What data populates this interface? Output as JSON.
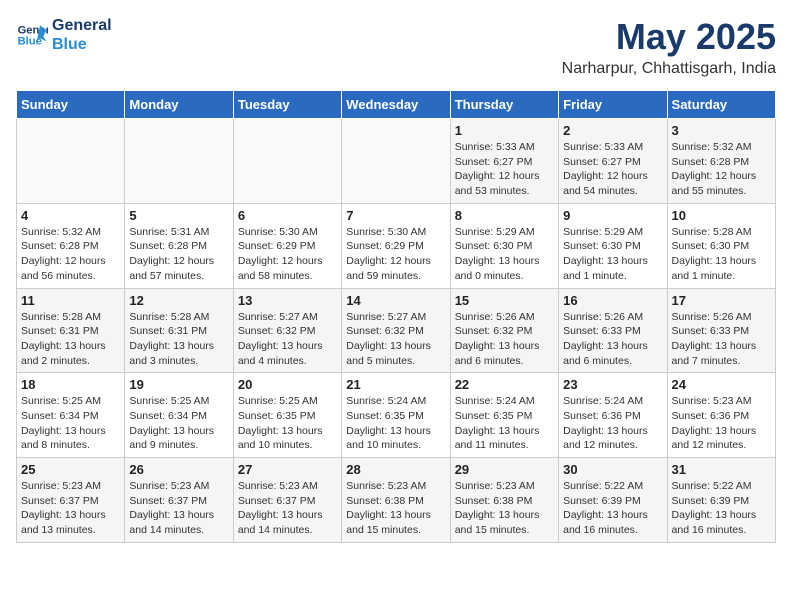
{
  "logo": {
    "line1": "General",
    "line2": "Blue"
  },
  "title": "May 2025",
  "subtitle": "Narharpur, Chhattisgarh, India",
  "days_of_week": [
    "Sunday",
    "Monday",
    "Tuesday",
    "Wednesday",
    "Thursday",
    "Friday",
    "Saturday"
  ],
  "weeks": [
    [
      {
        "day": "",
        "info": ""
      },
      {
        "day": "",
        "info": ""
      },
      {
        "day": "",
        "info": ""
      },
      {
        "day": "",
        "info": ""
      },
      {
        "day": "1",
        "info": "Sunrise: 5:33 AM\nSunset: 6:27 PM\nDaylight: 12 hours\nand 53 minutes."
      },
      {
        "day": "2",
        "info": "Sunrise: 5:33 AM\nSunset: 6:27 PM\nDaylight: 12 hours\nand 54 minutes."
      },
      {
        "day": "3",
        "info": "Sunrise: 5:32 AM\nSunset: 6:28 PM\nDaylight: 12 hours\nand 55 minutes."
      }
    ],
    [
      {
        "day": "4",
        "info": "Sunrise: 5:32 AM\nSunset: 6:28 PM\nDaylight: 12 hours\nand 56 minutes."
      },
      {
        "day": "5",
        "info": "Sunrise: 5:31 AM\nSunset: 6:28 PM\nDaylight: 12 hours\nand 57 minutes."
      },
      {
        "day": "6",
        "info": "Sunrise: 5:30 AM\nSunset: 6:29 PM\nDaylight: 12 hours\nand 58 minutes."
      },
      {
        "day": "7",
        "info": "Sunrise: 5:30 AM\nSunset: 6:29 PM\nDaylight: 12 hours\nand 59 minutes."
      },
      {
        "day": "8",
        "info": "Sunrise: 5:29 AM\nSunset: 6:30 PM\nDaylight: 13 hours\nand 0 minutes."
      },
      {
        "day": "9",
        "info": "Sunrise: 5:29 AM\nSunset: 6:30 PM\nDaylight: 13 hours\nand 1 minute."
      },
      {
        "day": "10",
        "info": "Sunrise: 5:28 AM\nSunset: 6:30 PM\nDaylight: 13 hours\nand 1 minute."
      }
    ],
    [
      {
        "day": "11",
        "info": "Sunrise: 5:28 AM\nSunset: 6:31 PM\nDaylight: 13 hours\nand 2 minutes."
      },
      {
        "day": "12",
        "info": "Sunrise: 5:28 AM\nSunset: 6:31 PM\nDaylight: 13 hours\nand 3 minutes."
      },
      {
        "day": "13",
        "info": "Sunrise: 5:27 AM\nSunset: 6:32 PM\nDaylight: 13 hours\nand 4 minutes."
      },
      {
        "day": "14",
        "info": "Sunrise: 5:27 AM\nSunset: 6:32 PM\nDaylight: 13 hours\nand 5 minutes."
      },
      {
        "day": "15",
        "info": "Sunrise: 5:26 AM\nSunset: 6:32 PM\nDaylight: 13 hours\nand 6 minutes."
      },
      {
        "day": "16",
        "info": "Sunrise: 5:26 AM\nSunset: 6:33 PM\nDaylight: 13 hours\nand 6 minutes."
      },
      {
        "day": "17",
        "info": "Sunrise: 5:26 AM\nSunset: 6:33 PM\nDaylight: 13 hours\nand 7 minutes."
      }
    ],
    [
      {
        "day": "18",
        "info": "Sunrise: 5:25 AM\nSunset: 6:34 PM\nDaylight: 13 hours\nand 8 minutes."
      },
      {
        "day": "19",
        "info": "Sunrise: 5:25 AM\nSunset: 6:34 PM\nDaylight: 13 hours\nand 9 minutes."
      },
      {
        "day": "20",
        "info": "Sunrise: 5:25 AM\nSunset: 6:35 PM\nDaylight: 13 hours\nand 10 minutes."
      },
      {
        "day": "21",
        "info": "Sunrise: 5:24 AM\nSunset: 6:35 PM\nDaylight: 13 hours\nand 10 minutes."
      },
      {
        "day": "22",
        "info": "Sunrise: 5:24 AM\nSunset: 6:35 PM\nDaylight: 13 hours\nand 11 minutes."
      },
      {
        "day": "23",
        "info": "Sunrise: 5:24 AM\nSunset: 6:36 PM\nDaylight: 13 hours\nand 12 minutes."
      },
      {
        "day": "24",
        "info": "Sunrise: 5:23 AM\nSunset: 6:36 PM\nDaylight: 13 hours\nand 12 minutes."
      }
    ],
    [
      {
        "day": "25",
        "info": "Sunrise: 5:23 AM\nSunset: 6:37 PM\nDaylight: 13 hours\nand 13 minutes."
      },
      {
        "day": "26",
        "info": "Sunrise: 5:23 AM\nSunset: 6:37 PM\nDaylight: 13 hours\nand 14 minutes."
      },
      {
        "day": "27",
        "info": "Sunrise: 5:23 AM\nSunset: 6:37 PM\nDaylight: 13 hours\nand 14 minutes."
      },
      {
        "day": "28",
        "info": "Sunrise: 5:23 AM\nSunset: 6:38 PM\nDaylight: 13 hours\nand 15 minutes."
      },
      {
        "day": "29",
        "info": "Sunrise: 5:23 AM\nSunset: 6:38 PM\nDaylight: 13 hours\nand 15 minutes."
      },
      {
        "day": "30",
        "info": "Sunrise: 5:22 AM\nSunset: 6:39 PM\nDaylight: 13 hours\nand 16 minutes."
      },
      {
        "day": "31",
        "info": "Sunrise: 5:22 AM\nSunset: 6:39 PM\nDaylight: 13 hours\nand 16 minutes."
      }
    ]
  ]
}
